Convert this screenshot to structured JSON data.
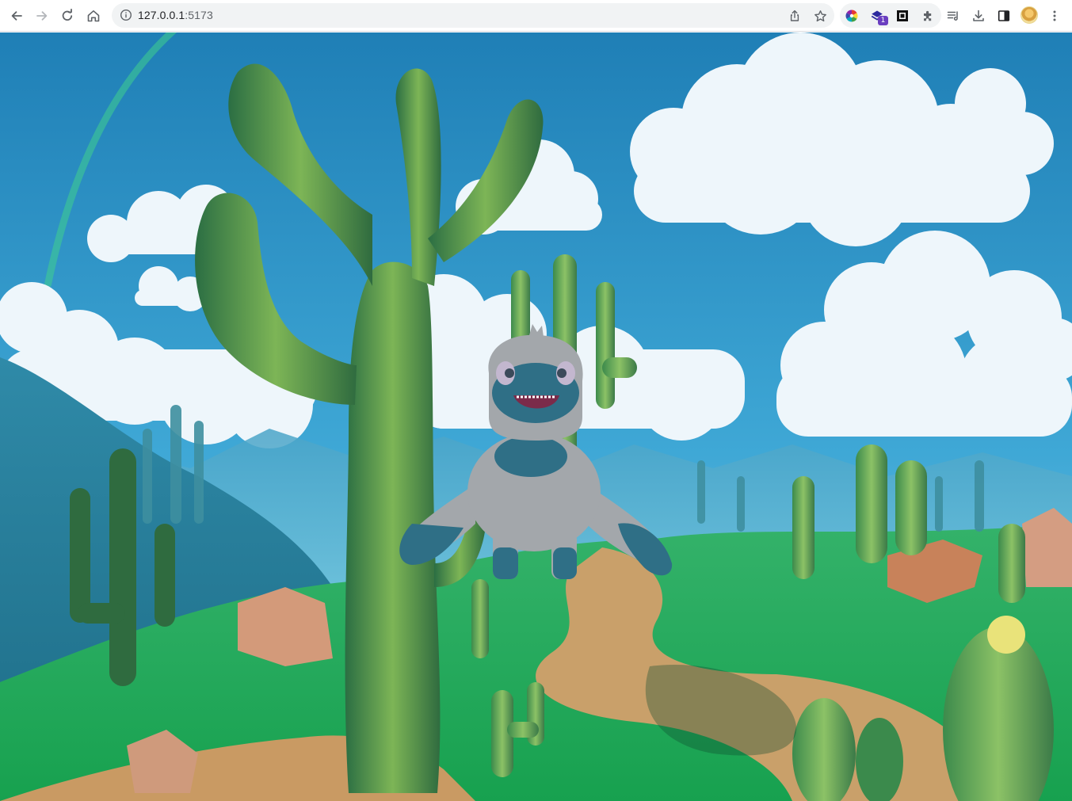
{
  "browser": {
    "url_host": "127.0.0.1",
    "url_port": ":5173",
    "extension_badge": "1",
    "icons": {
      "back": "arrow-left-icon",
      "forward": "arrow-right-icon",
      "reload": "reload-icon",
      "home": "home-icon",
      "site_info": "info-icon",
      "share": "share-icon",
      "bookmark": "star-icon",
      "extension_color": "color-wheel-icon",
      "extension_stack": "stack-icon",
      "extension_square": "square-frame-icon",
      "extensions_menu": "puzzle-icon",
      "reading_list": "reading-list-icon",
      "downloads": "download-icon",
      "side_panel": "side-panel-icon",
      "profile": "avatar",
      "menu": "kebab-menu-icon"
    }
  },
  "scene": {
    "description_tags": [
      "desert",
      "cactus",
      "clouds",
      "sky",
      "path",
      "rocks",
      "creature"
    ],
    "colors": {
      "sky_top": "#1f7fb6",
      "sky_bottom": "#3fa8d6",
      "cloud": "#eef6fb",
      "ground_green": "#1fa455",
      "path_sand": "#c9a06a",
      "cactus_dark": "#2f6b3f",
      "cactus_light": "#8fbf5a",
      "creature_body": "#a3a7ab",
      "creature_accent": "#2f6f86"
    }
  }
}
